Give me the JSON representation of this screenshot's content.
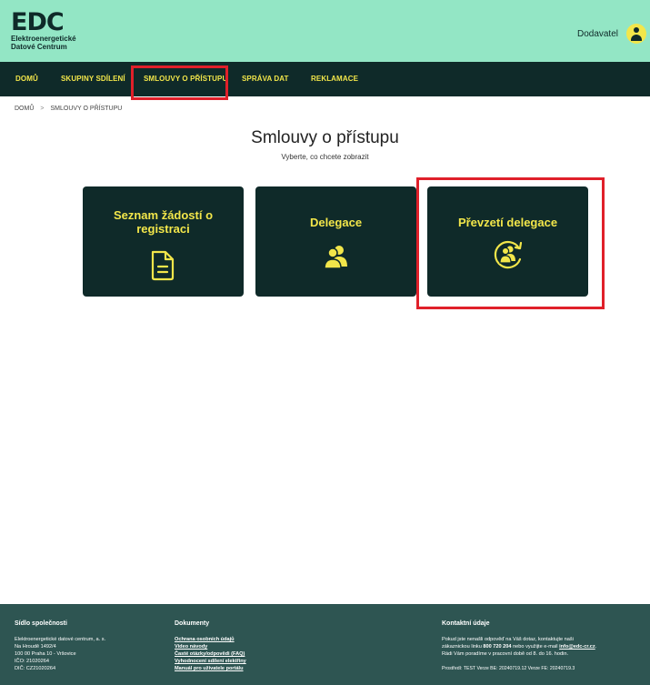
{
  "header": {
    "logo_mark": "EDC",
    "logo_line1": "Elektroenergetické",
    "logo_line2": "Datové Centrum",
    "user_label": "Dodavatel"
  },
  "nav": {
    "items": [
      {
        "label": "DOMŮ"
      },
      {
        "label": "SKUPINY SDÍLENÍ"
      },
      {
        "label": "SMLOUVY O PŘÍSTUPU",
        "active": true
      },
      {
        "label": "SPRÁVA DAT"
      },
      {
        "label": "REKLAMACE"
      }
    ]
  },
  "breadcrumb": {
    "home": "DOMŮ",
    "separator": ">",
    "current": "SMLOUVY O PŘÍSTUPU"
  },
  "page": {
    "title": "Smlouvy o přístupu",
    "subtitle": "Vyberte, co chcete zobrazit"
  },
  "cards": [
    {
      "title": "Seznam žádostí o registraci",
      "icon": "document-icon"
    },
    {
      "title": "Delegace",
      "icon": "users-icon"
    },
    {
      "title": "Převzetí delegace",
      "icon": "users-cycle-icon"
    }
  ],
  "footer": {
    "company": {
      "heading": "Sídlo společnosti",
      "lines": [
        "Elektroenergetické datové centrum, a. s.",
        "Na Hroudě 1492/4",
        "100 00 Praha 10 - Vršovice",
        "IČO: 21020264",
        "DIČ: CZ21020264"
      ]
    },
    "documents": {
      "heading": "Dokumenty",
      "links": [
        "Ochrana osobních údajů",
        "Video návody",
        "Časté otázky/odpovědi (FAQ)",
        "Vyhodnocení sdílení elektřiny",
        "Manuál pro uživatele portálu"
      ]
    },
    "contact": {
      "heading": "Kontaktní údaje",
      "line1": "Pokud jste nenašli odpověď na Váš dotaz, kontaktujte naši",
      "line2_pre": "zákaznickou linku ",
      "phone": "800 720 204",
      "line2_mid": " nebo využijte e-mail ",
      "email": "info@edc-cr.cz",
      "line2_post": ".",
      "line3": "Rádi Vám poradíme v pracovní době od 8. do 16. hodin.",
      "version": "Prostředí: TEST    Verze BE: 20240719.12    Verze FE: 20240719.3"
    }
  },
  "colors": {
    "header_bg": "#93e6c5",
    "nav_bg": "#0f2a29",
    "accent": "#f2e64a",
    "footer_bg": "#2e5552",
    "highlight": "#e0202a"
  }
}
